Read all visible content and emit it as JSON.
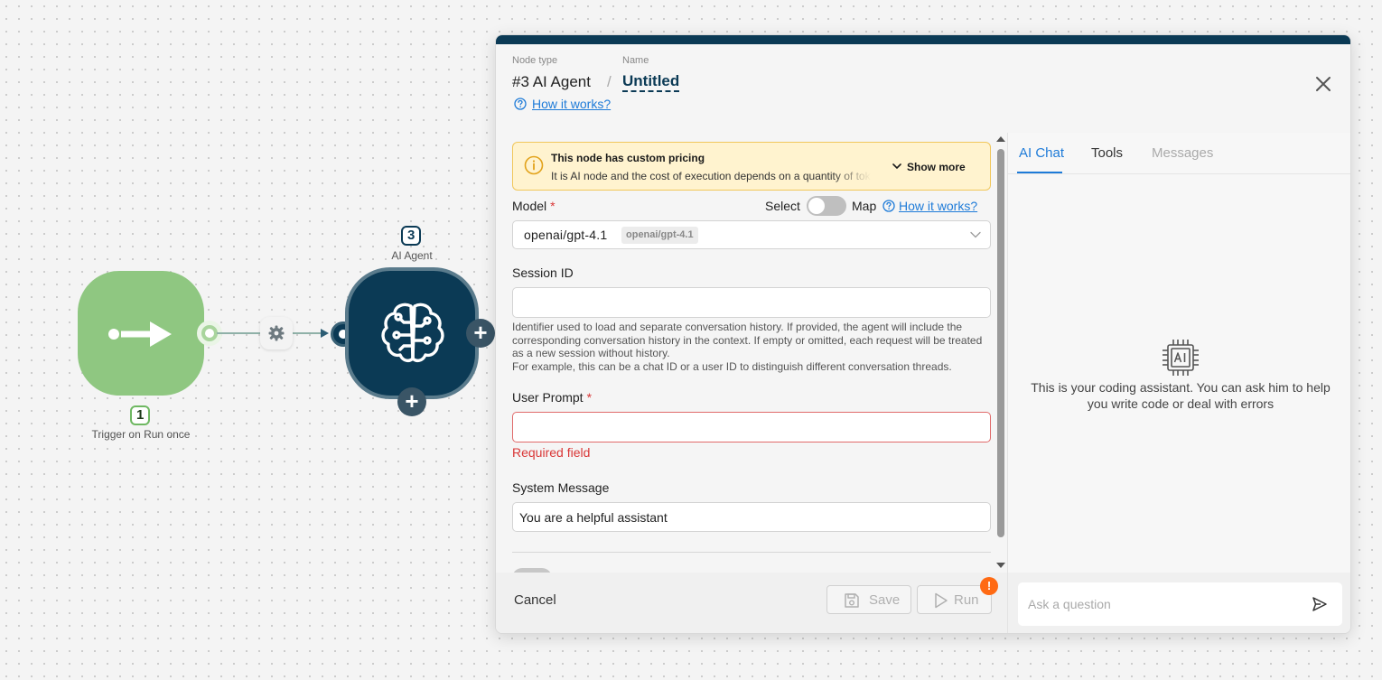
{
  "canvas": {
    "trigger": {
      "index": "1",
      "caption": "Trigger on Run once"
    },
    "agent": {
      "index": "3",
      "caption": "AI Agent"
    }
  },
  "panel": {
    "header": {
      "node_type_label": "Node type",
      "node_type_value": "#3 AI Agent",
      "separator": "/",
      "name_label": "Name",
      "name_value": "Untitled",
      "how_link": "How it works?"
    },
    "notice": {
      "title": "This node has custom pricing",
      "text": "It is AI node and the cost of execution depends on a quantity of tokens",
      "show_more": "Show more"
    },
    "model": {
      "label": "Model",
      "required_mark": "*",
      "select_label": "Select",
      "map_label": "Map",
      "how_link": "How it works?",
      "value": "openai/gpt-4.1",
      "chip": "openai/gpt-4.1"
    },
    "session": {
      "label": "Session ID",
      "value": "",
      "helper_line1": "Identifier used to load and separate conversation history. If provided, the agent will include the corresponding conversation history in the context. If empty or omitted, each request will be treated as a new session without history.",
      "helper_line2": "For example, this can be a chat ID or a user ID to distinguish different conversation threads."
    },
    "prompt": {
      "label": "User Prompt",
      "required_mark": "*",
      "value": "",
      "error": "Required field"
    },
    "system": {
      "label": "System Message",
      "value": "You are a helpful assistant"
    },
    "footer": {
      "cancel": "Cancel",
      "save": "Save",
      "run": "Run",
      "alert": "!"
    },
    "chat": {
      "tabs": [
        "AI Chat",
        "Tools",
        "Messages"
      ],
      "empty_text": "This is your coding assistant. You can ask him to help you write code or deal with errors",
      "input_placeholder": "Ask a question"
    }
  },
  "colors": {
    "trigger_green": "#8fc781",
    "agent_navy": "#0b3a55",
    "link_blue": "#1e7bd8",
    "error_red": "#d93636",
    "alert_orange": "#ff6a13",
    "notice_bg": "#fff3cf"
  },
  "icons": {
    "trigger": "arrow-right-icon",
    "connector": "gear-icon",
    "agent": "brain-circuit-icon",
    "notice": "info-icon",
    "close": "close-icon",
    "chat_empty": "ai-chip-icon",
    "send": "send-icon",
    "save": "save-icon",
    "run": "play-icon"
  }
}
